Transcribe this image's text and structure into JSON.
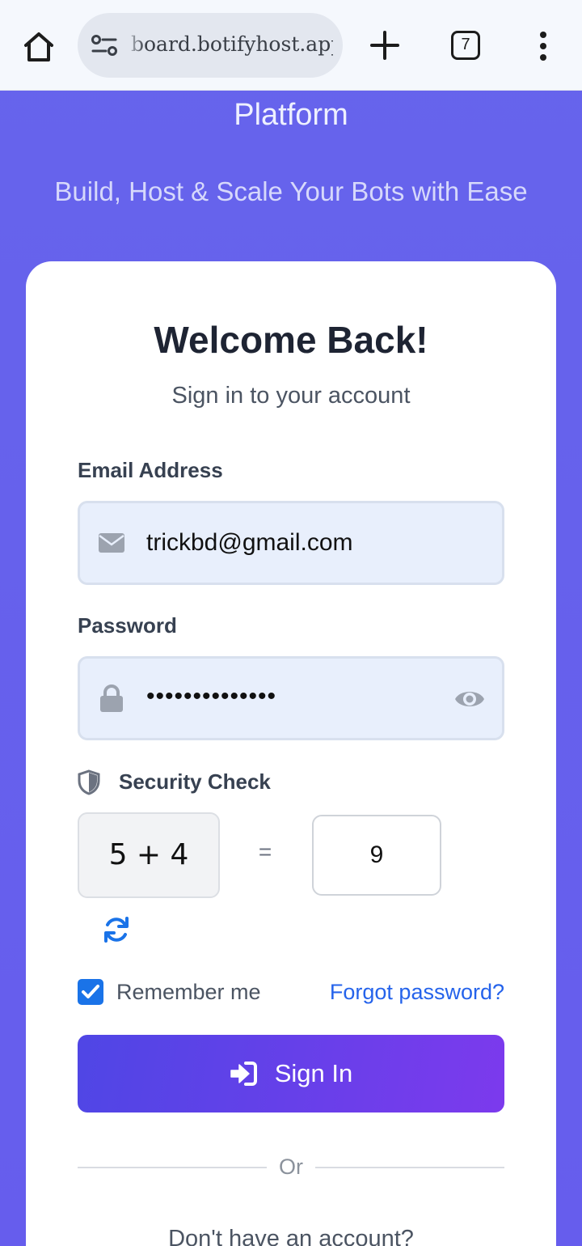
{
  "browser": {
    "url": "board.botifyhost.app",
    "tab_count": "7"
  },
  "hero": {
    "title": "Professional Telegram Bot Hosting Platform",
    "subtitle": "Build, Host & Scale Your Bots with Ease"
  },
  "login": {
    "title": "Welcome Back!",
    "subtitle": "Sign in to your account",
    "email_label": "Email Address",
    "email_value": "trickbd@gmail.com",
    "password_label": "Password",
    "password_value": "••••••••••••••",
    "security_label": "Security Check",
    "captcha_question": "5 + 4",
    "equals": "=",
    "captcha_answer": "9",
    "remember_label": "Remember me",
    "remember_checked": true,
    "forgot_label": "Forgot password?",
    "signin_label": "Sign In",
    "divider_text": "Or",
    "signup_prompt": "Don't have an account?"
  },
  "colors": {
    "background": "#6664ec",
    "button_start": "#4f46e5",
    "button_end": "#7c3aed",
    "link": "#2563eb",
    "checkbox": "#1a73e8"
  },
  "icons": {
    "home": "home-icon",
    "site_info": "site-info-icon",
    "new_tab": "plus-icon",
    "menu": "more-vert-icon",
    "email": "envelope-icon",
    "password": "lock-icon",
    "toggle_password": "eye-icon",
    "security": "shield-icon",
    "refresh": "refresh-icon",
    "sign_in": "sign-in-icon"
  }
}
